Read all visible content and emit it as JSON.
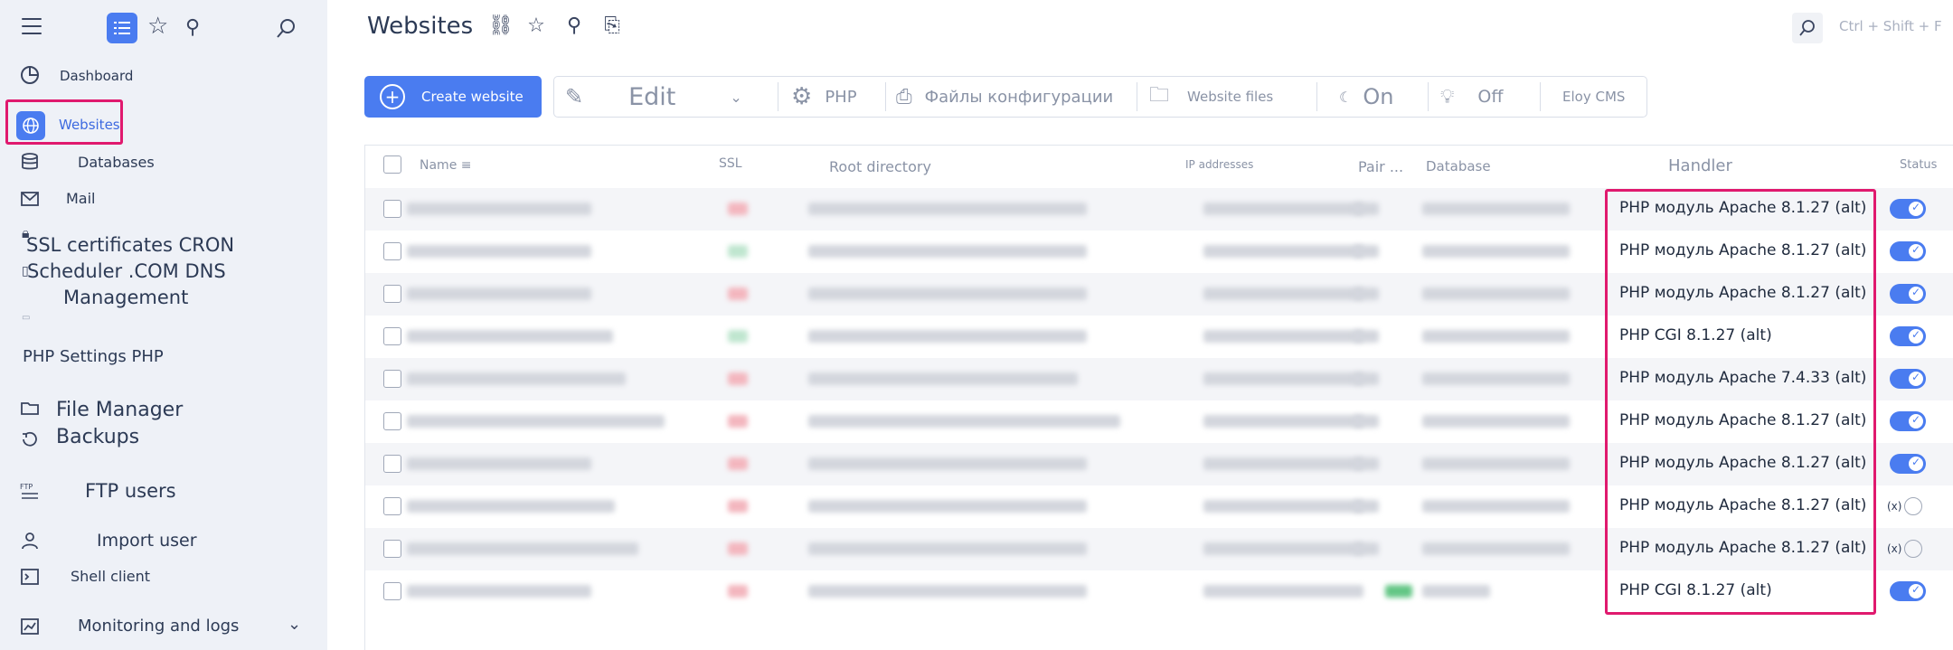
{
  "sidebar": {
    "items": [
      {
        "label": "Dashboard",
        "icon": "dashboard-icon"
      },
      {
        "label": "Websites",
        "icon": "globe-icon"
      },
      {
        "label": "Databases",
        "icon": "database-icon"
      },
      {
        "label": "Mail",
        "icon": "mail-icon"
      },
      {
        "label": "SSL certificates CRON",
        "icon": "lock-icon"
      },
      {
        "label": "Scheduler .COM DNS",
        "icon": "calendar-icon"
      },
      {
        "label": "Management",
        "icon": "dns-icon"
      },
      {
        "label": "PHP Settings PHP",
        "icon": "php-icon"
      },
      {
        "label": "File Manager",
        "icon": "folder-icon"
      },
      {
        "label": "Backups",
        "icon": "backup-icon"
      },
      {
        "label": "FTP users",
        "icon": "ftp-icon"
      },
      {
        "label": "Import user",
        "icon": "import-user-icon"
      },
      {
        "label": "Shell client",
        "icon": "terminal-icon"
      },
      {
        "label": "Monitoring and logs",
        "icon": "chart-icon"
      }
    ]
  },
  "header": {
    "title": "Websites",
    "shortcut": "Ctrl + Shift + F"
  },
  "toolbar": {
    "create_label": "Create website",
    "edit_label": "Edit",
    "php_label": "PHP",
    "config_label": "Файлы конфигурации",
    "files_label": "Website files",
    "on_label": "On",
    "off_label": "Off",
    "cms_label": "Eloy CMS"
  },
  "table": {
    "columns": {
      "name": "Name ≡",
      "ssl": "SSL",
      "root": "Root directory",
      "ip": "IP addresses",
      "pair": "Pair ...",
      "database": "Database",
      "handler": "Handler",
      "status": "Status"
    },
    "rows": [
      {
        "handler": "PHP модуль Apache 8.1.27 (alt)",
        "status": "on"
      },
      {
        "handler": "PHP модуль Apache 8.1.27 (alt)",
        "status": "on"
      },
      {
        "handler": "PHP модуль Apache 8.1.27 (alt)",
        "status": "on"
      },
      {
        "handler": "PHP CGI 8.1.27 (alt)",
        "status": "on"
      },
      {
        "handler": "PHP модуль Apache 7.4.33 (alt)",
        "status": "on"
      },
      {
        "handler": "PHP модуль Apache 8.1.27 (alt)",
        "status": "on"
      },
      {
        "handler": "PHP модуль Apache 8.1.27 (alt)",
        "status": "on"
      },
      {
        "handler": "PHP модуль Apache 8.1.27 (alt)",
        "status": "off"
      },
      {
        "handler": "PHP модуль Apache 8.1.27 (alt)",
        "status": "off"
      },
      {
        "handler": "PHP CGI 8.1.27 (alt)",
        "status": "on"
      }
    ],
    "off_marker": "(x)"
  },
  "colors": {
    "accent": "#4a7cf0",
    "highlight": "#e0196e",
    "sidebar_bg": "#eef1f7"
  }
}
